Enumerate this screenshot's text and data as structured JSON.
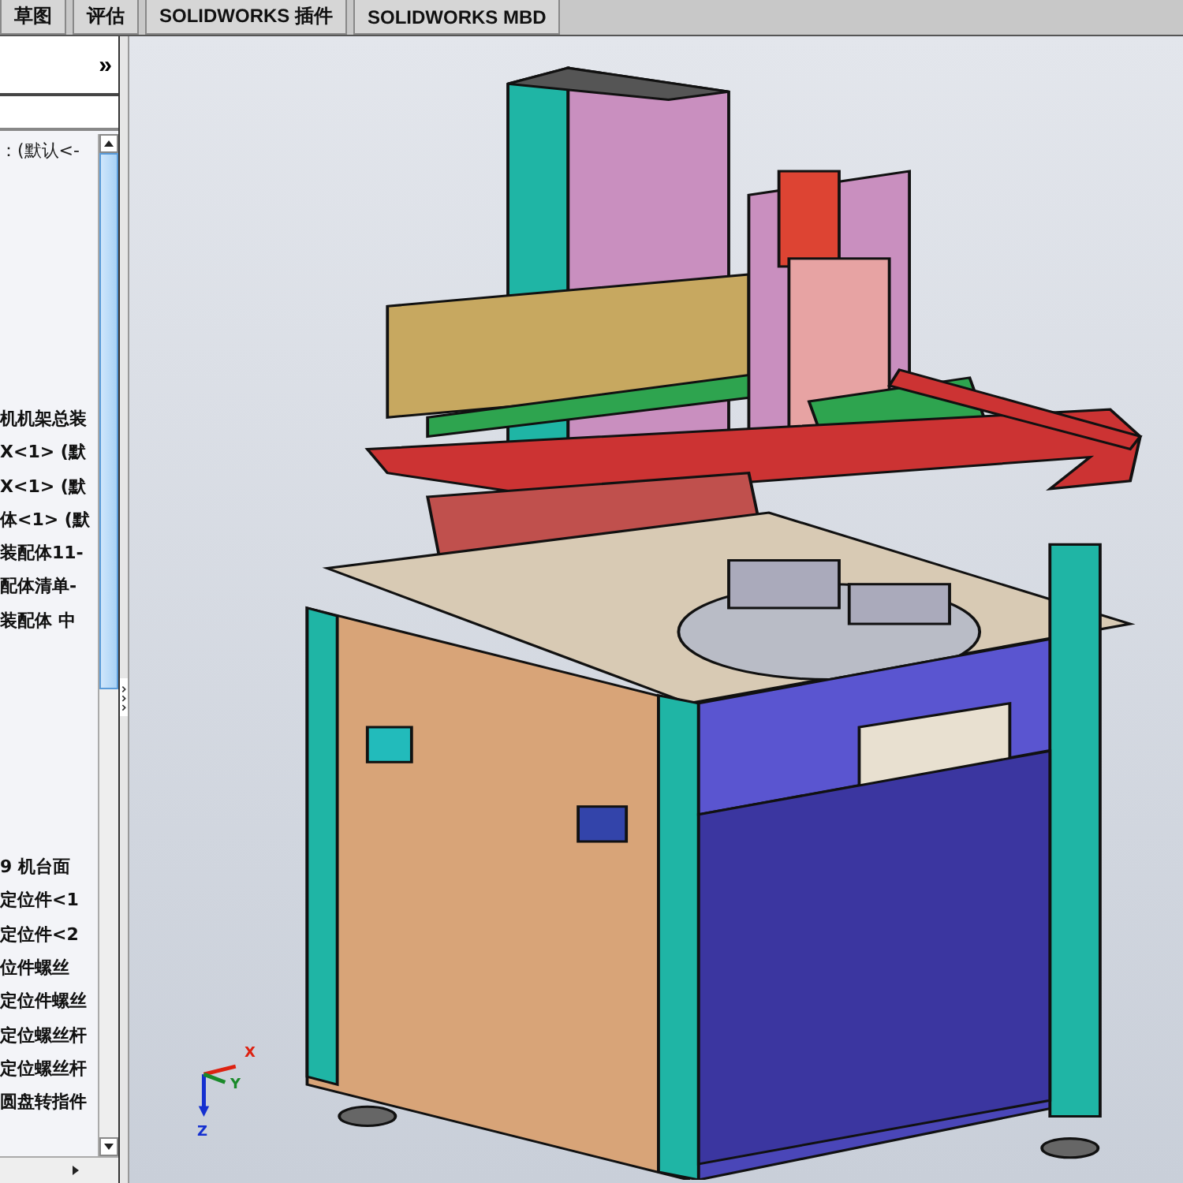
{
  "tabs": [
    {
      "label": "草图",
      "selected": false
    },
    {
      "label": "评估",
      "selected": false
    },
    {
      "label": "SOLIDWORKS 插件",
      "selected": false
    },
    {
      "label": "SOLIDWORKS MBD",
      "selected": false
    }
  ],
  "panel": {
    "expand_glyph": "»",
    "config_label": "：(默认<-"
  },
  "tree": {
    "upper_items": [
      "机机架总装",
      "X<1> (默",
      "X<1> (默",
      "体<1> (默",
      "装配体11-",
      "配体清单-",
      "装配体 中"
    ],
    "lower_items": [
      "9 机台面",
      "定位件<1",
      "定位件<2",
      "位件螺丝",
      "定位件螺丝",
      "定位螺丝杆",
      "定位螺丝杆",
      "圆盘转指件"
    ]
  },
  "triad": {
    "x_label": "X",
    "y_label": "Y",
    "z_label": "Z"
  }
}
